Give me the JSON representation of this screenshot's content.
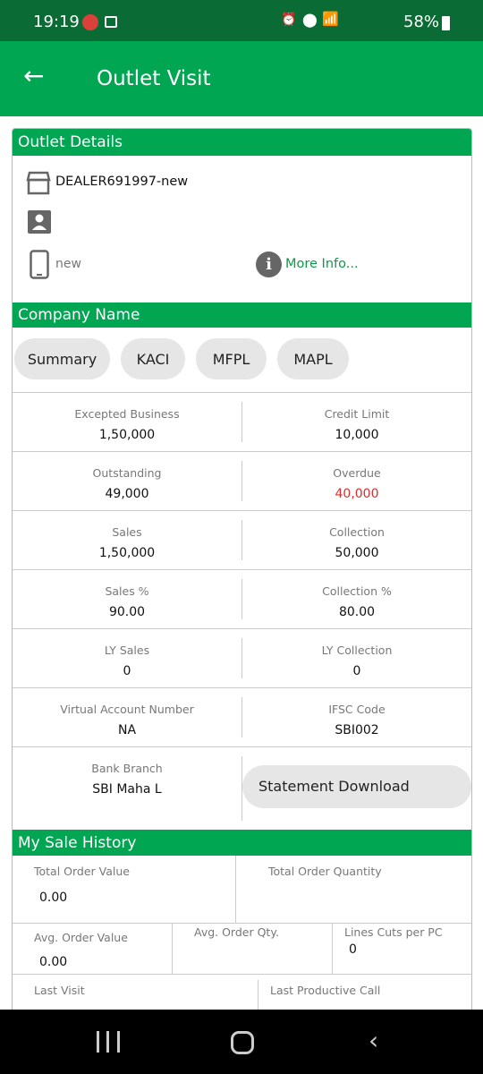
{
  "status_bar": {
    "time": "19:19",
    "battery": "58%"
  },
  "app_bar": {
    "title": "Outlet Visit"
  },
  "outlet_details": {
    "header": "Outlet Details",
    "outlet_name": "DEALER691997-new",
    "contact_name": "",
    "phone": "new",
    "more_info": "More Info..."
  },
  "company": {
    "header": "Company Name",
    "tabs": [
      "Summary",
      "KACI",
      "MFPL",
      "MAPL"
    ]
  },
  "summary": [
    [
      {
        "label": "Excepted Business",
        "value": "1,50,000"
      },
      {
        "label": "Credit Limit",
        "value": "10,000"
      }
    ],
    [
      {
        "label": "Outstanding",
        "value": "49,000"
      },
      {
        "label": "Overdue",
        "value": "40,000",
        "color": "#d32f2f"
      }
    ],
    [
      {
        "label": "Sales",
        "value": "1,50,000"
      },
      {
        "label": "Collection",
        "value": "50,000"
      }
    ],
    [
      {
        "label": "Sales %",
        "value": "90.00"
      },
      {
        "label": "Collection %",
        "value": "80.00"
      }
    ],
    [
      {
        "label": "LY Sales",
        "value": "0"
      },
      {
        "label": "LY Collection",
        "value": "0"
      }
    ],
    [
      {
        "label": "Virtual Account Number",
        "value": "NA"
      },
      {
        "label": "IFSC Code",
        "value": "SBI002"
      }
    ]
  ],
  "bank": {
    "label": "Bank Branch",
    "value": "SBI Maha L",
    "statement_button": "Statement Download"
  },
  "sale_history": {
    "header": "My Sale History",
    "total_order_value": {
      "label": "Total Order Value",
      "value": "0.00"
    },
    "total_order_quantity": {
      "label": "Total Order Quantity",
      "value": ""
    },
    "avg_order_value": {
      "label": "Avg. Order Value",
      "value": "0.00"
    },
    "avg_order_qty": {
      "label": "Avg. Order Qty.",
      "value": ""
    },
    "lines_cuts": {
      "label": "Lines Cuts per PC",
      "value": "0"
    },
    "last_visit": {
      "label": "Last Visit"
    },
    "last_productive_call": {
      "label": "Last Productive Call"
    }
  },
  "colors": {
    "primary": "#00a651",
    "status_bar": "#0b6b34",
    "overdue": "#d32f2f",
    "link": "#0a9a4a"
  }
}
